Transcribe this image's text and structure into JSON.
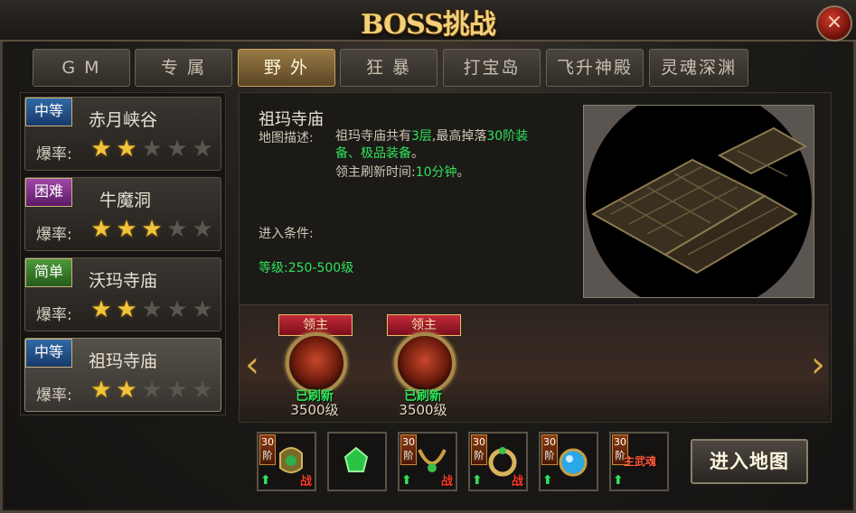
{
  "window": {
    "title": "BOSS挑战",
    "close_icon": "×"
  },
  "tabs": [
    {
      "label": "G M"
    },
    {
      "label": "专 属"
    },
    {
      "label": "野 外",
      "active": true
    },
    {
      "label": "狂 暴"
    },
    {
      "label": "打宝岛"
    },
    {
      "label": "飞升神殿"
    },
    {
      "label": "灵魂深渊"
    }
  ],
  "boss_list": [
    {
      "difficulty": "中等",
      "name": "赤月峡谷",
      "rate_label": "爆率:",
      "stars": 2,
      "max_stars": 5
    },
    {
      "difficulty": "困难",
      "name": "牛魔洞",
      "rate_label": "爆率:",
      "stars": 3,
      "max_stars": 5
    },
    {
      "difficulty": "简单",
      "name": "沃玛寺庙",
      "rate_label": "爆率:",
      "stars": 2,
      "max_stars": 5
    },
    {
      "difficulty": "中等",
      "name": "祖玛寺庙",
      "rate_label": "爆率:",
      "stars": 2,
      "max_stars": 5,
      "selected": true
    }
  ],
  "detail": {
    "map_name": "祖玛寺庙",
    "desc_label": "地图描述:",
    "desc_part1": "祖玛寺庙共有",
    "desc_floors": "3层",
    "desc_part2": ",最高掉落",
    "desc_drop1": "30阶装",
    "desc_drop2": "备、极品装备",
    "desc_end": "。",
    "refresh_label": "领主刷新时间:",
    "refresh_time": "10分钟",
    "refresh_end": "。",
    "condition_label": "进入条件:",
    "level_requirement": "等级:250-500级"
  },
  "bosses": [
    {
      "tag": "领主",
      "status": "已刷新",
      "level": "3500级"
    },
    {
      "tag": "领主",
      "status": "已刷新",
      "level": "3500级"
    }
  ],
  "rewards": [
    {
      "tier": "30阶",
      "battle": "战"
    },
    {
      "tier": "",
      "battle": ""
    },
    {
      "tier": "30阶",
      "battle": "战"
    },
    {
      "tier": "30阶",
      "battle": "战"
    },
    {
      "tier": "30阶",
      "battle": ""
    },
    {
      "tier": "30阶",
      "battle": "",
      "label": "主武魂"
    }
  ],
  "enter_button": "进入地图",
  "nav": {
    "prev_icon": "‹",
    "next_icon": "›"
  }
}
